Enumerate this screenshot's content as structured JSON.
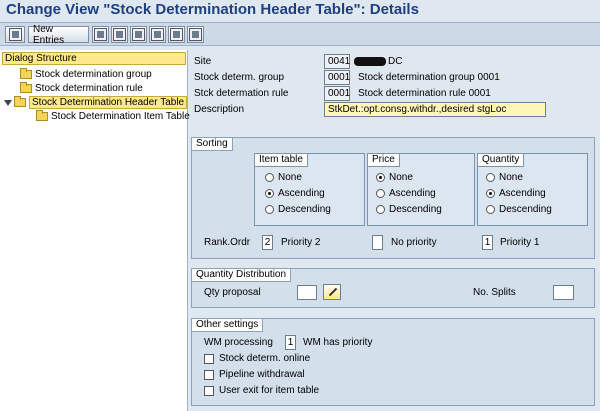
{
  "title": "Change View \"Stock Determination Header Table\": Details",
  "toolbar": {
    "new_entries": "New Entries"
  },
  "tree": {
    "header": "Dialog Structure",
    "items": [
      "Stock determination group",
      "Stock determination rule",
      "Stock Determination Header Table",
      "Stock Determination Item Table"
    ]
  },
  "header_fields": {
    "site_label": "Site",
    "site_value": "0041",
    "site_suffix": "DC",
    "group_label": "Stock determ. group",
    "group_value": "0001",
    "group_text": "Stock determination group 0001",
    "rule_label": "Stck determation rule",
    "rule_value": "0001",
    "rule_text": "Stock determination rule 0001",
    "desc_label": "Description",
    "desc_value": "StkDet.:opt.consg.withdr.,desired stgLoc"
  },
  "sorting": {
    "title": "Sorting",
    "item_table": {
      "title": "Item table",
      "opt1": "None",
      "opt2": "Ascending",
      "opt3": "Descending"
    },
    "price": {
      "title": "Price",
      "opt1": "None",
      "opt2": "Ascending",
      "opt3": "Descending"
    },
    "quantity": {
      "title": "Quantity",
      "opt1": "None",
      "opt2": "Ascending",
      "opt3": "Descending"
    },
    "rank_label": "Rank.Ordr",
    "rank1_value": "2",
    "rank1_text": "Priority 2",
    "rank2_value": "",
    "rank2_text": "No priority",
    "rank3_value": "1",
    "rank3_text": "Priority 1"
  },
  "quantity_distribution": {
    "title": "Quantity Distribution",
    "qty_proposal_label": "Qty proposal",
    "qty_proposal_value": "",
    "no_splits_label": "No. Splits",
    "no_splits_value": ""
  },
  "other_settings": {
    "title": "Other settings",
    "wm_label": "WM processing",
    "wm_value": "1",
    "wm_text": "WM has priority",
    "check1": "Stock determ. online",
    "check2": "Pipeline withdrawal",
    "check3": "User exit for item table"
  },
  "colors": {
    "title": "#1f3f80",
    "highlight": "#ffe98a",
    "panel": "#d3dfeb"
  }
}
